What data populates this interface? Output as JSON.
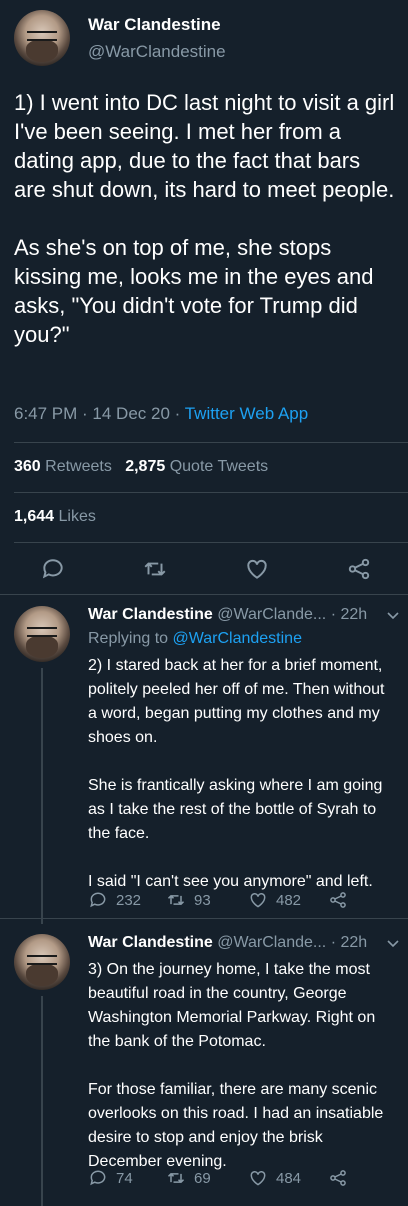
{
  "main_tweet": {
    "name": "War Clandestine",
    "handle": "@WarClandestine",
    "paragraph_1": "1) I went into DC last night to visit a girl I've been seeing. I met her from a dating app, due to the fact that bars are shut down, its hard to meet people.",
    "paragraph_2": "As she's on top of me, she stops kissing me, looks me in the eyes and asks, \"You didn't vote for Trump did you?\"",
    "time": "6:47 PM",
    "date": "14 Dec 20",
    "source": "Twitter Web App",
    "retweets_count": "360",
    "retweets_label": "Retweets",
    "quotes_count": "2,875",
    "quotes_label": "Quote Tweets",
    "likes_count": "1,644",
    "likes_label": "Likes"
  },
  "replies": [
    {
      "name": "War Clandestine",
      "handle": "@WarClande...",
      "age": "22h",
      "replying_prefix": "Replying to",
      "replying_to": "@WarClandestine",
      "paragraphs": [
        "2) I stared back at her for a brief moment, politely peeled her off of me. Then without a word, began putting my clothes and my shoes on.",
        "She is frantically asking where I am going as I take the rest of the bottle of Syrah to the face.",
        "I said \"I can't see you anymore\" and left."
      ],
      "replies": "232",
      "retweets": "93",
      "likes": "482"
    },
    {
      "name": "War Clandestine",
      "handle": "@WarClande...",
      "age": "22h",
      "paragraphs": [
        "3) On the journey home, I take the most beautiful road in the country, George Washington Memorial Parkway. Right on the bank of the Potomac.",
        "For those familiar, there are many scenic overlooks on this road. I had an insatiable desire to stop and enjoy the brisk December evening."
      ],
      "replies": "74",
      "retweets": "69",
      "likes": "484"
    }
  ],
  "colors": {
    "background": "#15202b",
    "muted": "#8899a6",
    "link": "#1da1f2",
    "divider": "#38444d"
  }
}
